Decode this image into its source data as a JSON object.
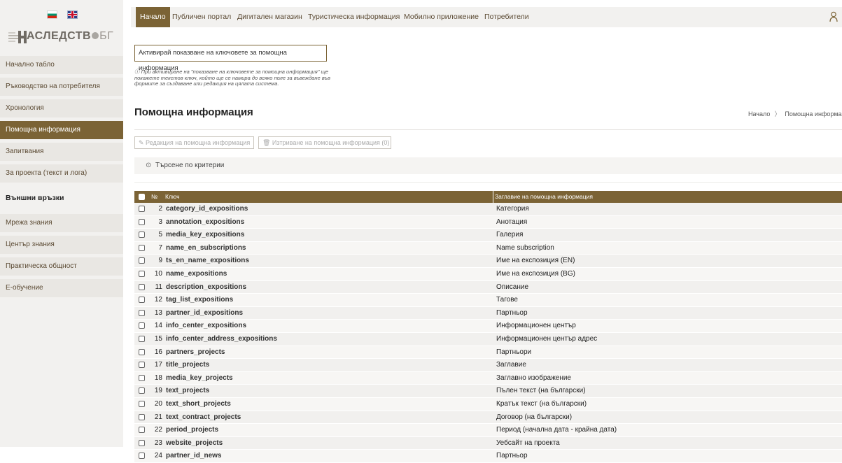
{
  "logo": {
    "text_main": "АСЛЕДСТВ",
    "text_suffix": "БГ"
  },
  "sidebar": {
    "items": [
      {
        "label": "Начално табло"
      },
      {
        "label": "Ръководство на потребителя"
      },
      {
        "label": "Хронология"
      },
      {
        "label": "Помощна информация",
        "active": true
      },
      {
        "label": "Запитвания"
      },
      {
        "label": "За проекта (текст и лога)"
      }
    ],
    "section_title": "Външни връзки",
    "external": [
      {
        "label": "Мрежа знания"
      },
      {
        "label": "Център знания"
      },
      {
        "label": "Практическа общност"
      },
      {
        "label": "Е-обучение"
      }
    ]
  },
  "topnav": {
    "tabs": [
      {
        "label": "Начало",
        "active": true
      },
      {
        "label": "Публичен портал"
      },
      {
        "label": "Дигитален магазин"
      },
      {
        "label": "Туристическа информация"
      },
      {
        "label": "Мобилно приложение"
      },
      {
        "label": "Потребители"
      }
    ]
  },
  "info_toggle": {
    "button_label": "Активирай показване на ключовете за помощна информация",
    "hint_line1": "ⓘ При активиране на \"показване на ключовете за помощна информация\" ще",
    "hint_line2": "покажете текстов ключ, който ще се намира до всяко поле за въвеждане във",
    "hint_line3": "формите за създаване или редакция на цялата система."
  },
  "page": {
    "title": "Помощна информация",
    "breadcrumb_home": "Начало",
    "breadcrumb_sep": "〉",
    "breadcrumb_current": "Помощна информаци"
  },
  "actions": {
    "edit_label": "✎ Редакция на помощна информация",
    "delete_label": "🗑 Изтриване на помощна информация (0)"
  },
  "search": {
    "label": "Търсене по критерии",
    "chevron": "⊙"
  },
  "table": {
    "headers": {
      "num": "№",
      "key": "Ключ",
      "title": "Заглавие на помощна информация"
    },
    "rows": [
      {
        "num": "2",
        "key": "category_id_expositions",
        "title": "Категория"
      },
      {
        "num": "3",
        "key": "annotation_expositions",
        "title": "Анотация"
      },
      {
        "num": "5",
        "key": "media_key_expositions",
        "title": "Галерия"
      },
      {
        "num": "7",
        "key": "name_en_subscriptions",
        "title": "Name subscription"
      },
      {
        "num": "9",
        "key": "ts_en_name_expositions",
        "title": "Име на експозиция (EN)"
      },
      {
        "num": "10",
        "key": "name_expositions",
        "title": "Име на експозиция (BG)"
      },
      {
        "num": "11",
        "key": "description_expositions",
        "title": "Описание"
      },
      {
        "num": "12",
        "key": "tag_list_expositions",
        "title": "Тагове"
      },
      {
        "num": "13",
        "key": "partner_id_expositions",
        "title": "Партньор"
      },
      {
        "num": "14",
        "key": "info_center_expositions",
        "title": "Информационен център"
      },
      {
        "num": "15",
        "key": "info_center_address_expositions",
        "title": "Информационен център адрес"
      },
      {
        "num": "16",
        "key": "partners_projects",
        "title": "Партньори"
      },
      {
        "num": "17",
        "key": "title_projects",
        "title": "Заглавие"
      },
      {
        "num": "18",
        "key": "media_key_projects",
        "title": "Заглавно изображение"
      },
      {
        "num": "19",
        "key": "text_projects",
        "title": "Пълен текст (на български)"
      },
      {
        "num": "20",
        "key": "text_short_projects",
        "title": "Кратък текст (на български)"
      },
      {
        "num": "21",
        "key": "text_contract_projects",
        "title": "Договор (на български)"
      },
      {
        "num": "22",
        "key": "period_projects",
        "title": "Период (начална дата - крайна дата)"
      },
      {
        "num": "23",
        "key": "website_projects",
        "title": "Уебсайт на проекта"
      },
      {
        "num": "24",
        "key": "partner_id_news",
        "title": "Партньор"
      }
    ]
  },
  "colors": {
    "accent": "#7b6335",
    "sidebar_bg": "#f2f1ef",
    "nav_item_bg": "#e9e7e3"
  }
}
